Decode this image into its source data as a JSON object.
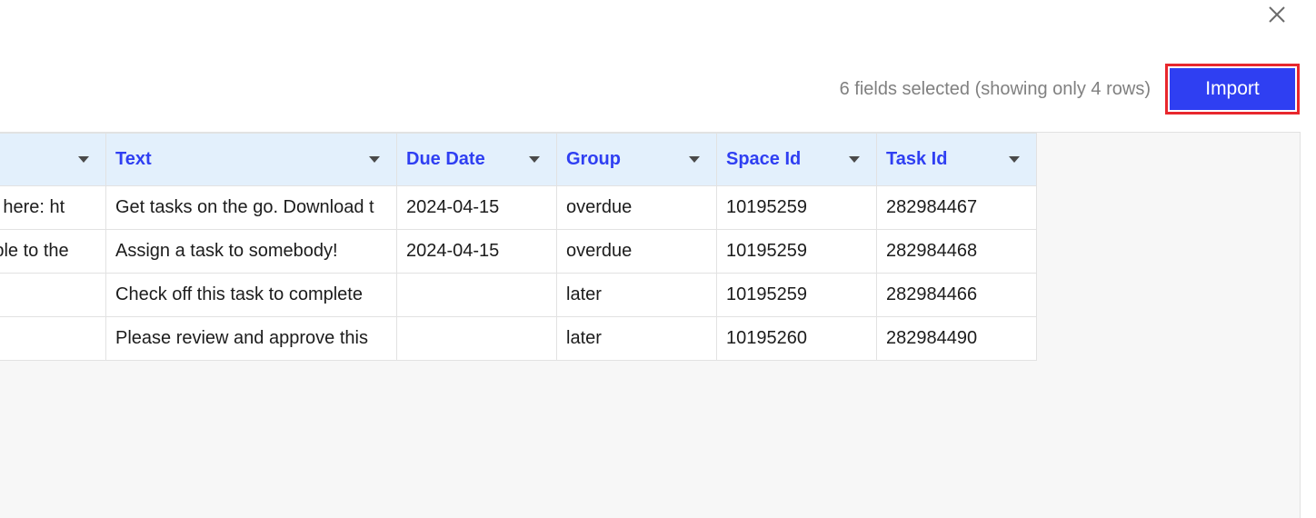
{
  "header": {
    "selection_info": "6 fields selected (showing only 4 rows)",
    "import_label": "Import",
    "close_icon": "close-icon"
  },
  "colors": {
    "accent": "#2f3ff2",
    "import_border": "#e8272d",
    "header_bg": "#e3f0fc",
    "grid_bg": "#f7f7f7"
  },
  "table": {
    "columns": [
      {
        "label": ""
      },
      {
        "label": "Text"
      },
      {
        "label": "Due Date"
      },
      {
        "label": "Group"
      },
      {
        "label": "Space Id"
      },
      {
        "label": "Task Id"
      }
    ],
    "rows": [
      [
        "able here: ht",
        "Get tasks on the go. Download t",
        "2024-04-15",
        "overdue",
        "10195259",
        "282984467"
      ],
      [
        "people to the",
        "Assign a task to somebody!",
        "2024-04-15",
        "overdue",
        "10195259",
        "282984468"
      ],
      [
        "",
        "Check off this task to complete",
        "",
        "later",
        "10195259",
        "282984466"
      ],
      [
        "",
        "Please review and approve this",
        "",
        "later",
        "10195260",
        "282984490"
      ]
    ]
  }
}
